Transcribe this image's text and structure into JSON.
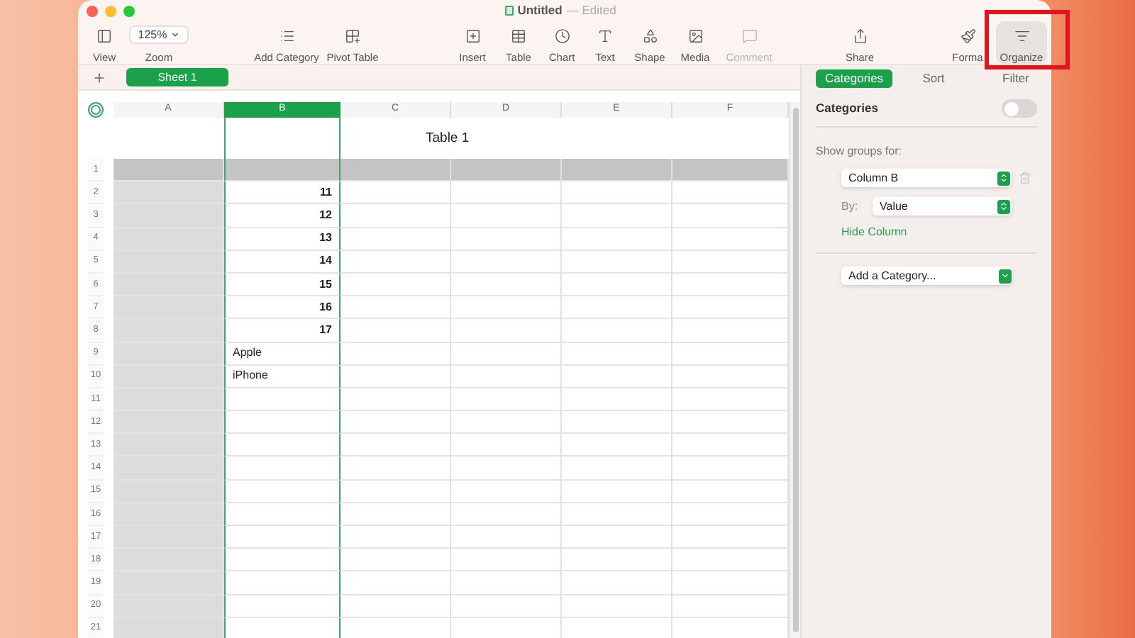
{
  "window": {
    "title": "Untitled",
    "status": "— Edited"
  },
  "toolbar": {
    "groups": [
      [
        {
          "label": "View",
          "kind": "button",
          "disabled": false,
          "selected": false
        },
        {
          "label": "Zoom",
          "kind": "dropdown",
          "value": "125%",
          "disabled": false,
          "selected": false
        }
      ],
      [
        {
          "label": "Add Category",
          "kind": "button",
          "disabled": false,
          "selected": false
        },
        {
          "label": "Pivot Table",
          "kind": "button",
          "disabled": false,
          "selected": false
        }
      ],
      [
        {
          "label": "Insert",
          "kind": "button",
          "disabled": false,
          "selected": false
        },
        {
          "label": "Table",
          "kind": "button",
          "disabled": false,
          "selected": false
        },
        {
          "label": "Chart",
          "kind": "button",
          "disabled": false,
          "selected": false
        },
        {
          "label": "Text",
          "kind": "button",
          "disabled": false,
          "selected": false
        },
        {
          "label": "Shape",
          "kind": "button",
          "disabled": false,
          "selected": false
        },
        {
          "label": "Media",
          "kind": "button",
          "disabled": false,
          "selected": false
        },
        {
          "label": "Comment",
          "kind": "button",
          "disabled": true,
          "selected": false
        }
      ],
      [
        {
          "label": "Share",
          "kind": "button",
          "disabled": false,
          "selected": false
        }
      ],
      [
        {
          "label": "Forma",
          "kind": "button",
          "disabled": false,
          "selected": false
        },
        {
          "label": "Organize",
          "kind": "button",
          "disabled": false,
          "selected": true
        }
      ]
    ]
  },
  "sheets": [
    {
      "label": "Sheet 1",
      "selected": true
    }
  ],
  "table": {
    "title": "Table 1",
    "columns": [
      {
        "label": "A",
        "selected": false
      },
      {
        "label": "B",
        "selected": true
      },
      {
        "label": "C",
        "selected": false
      },
      {
        "label": "D",
        "selected": false
      },
      {
        "label": "E",
        "selected": false
      },
      {
        "label": "F",
        "selected": false
      }
    ],
    "rows": [
      {
        "number": "1",
        "kind": "header"
      },
      {
        "number": "2",
        "value": "11",
        "kind": "number"
      },
      {
        "number": "3",
        "value": "12",
        "kind": "number"
      },
      {
        "number": "4",
        "value": "13",
        "kind": "number"
      },
      {
        "number": "5",
        "value": "14",
        "kind": "number"
      },
      {
        "number": "6",
        "value": "15",
        "kind": "number"
      },
      {
        "number": "7",
        "value": "16",
        "kind": "number"
      },
      {
        "number": "8",
        "value": "17",
        "kind": "number"
      },
      {
        "number": "9",
        "value": "Apple",
        "kind": "text"
      },
      {
        "number": "10",
        "value": "iPhone",
        "kind": "text"
      },
      {
        "number": "11"
      },
      {
        "number": "12"
      },
      {
        "number": "13"
      },
      {
        "number": "14"
      },
      {
        "number": "15"
      },
      {
        "number": "16"
      },
      {
        "number": "17"
      },
      {
        "number": "18"
      },
      {
        "number": "19"
      },
      {
        "number": "20"
      },
      {
        "number": "21"
      }
    ]
  },
  "sidebar": {
    "tabs": [
      {
        "label": "Categories",
        "selected": true
      },
      {
        "label": "Sort",
        "selected": false
      },
      {
        "label": "Filter",
        "selected": false
      }
    ],
    "categories_toggle": {
      "label": "Categories",
      "on": false
    },
    "show_groups_label": "Show groups for:",
    "group_column": "Column B",
    "by_label": "By:",
    "by_value": "Value",
    "hide_column_link": "Hide Column",
    "add_category": "Add a Category..."
  }
}
